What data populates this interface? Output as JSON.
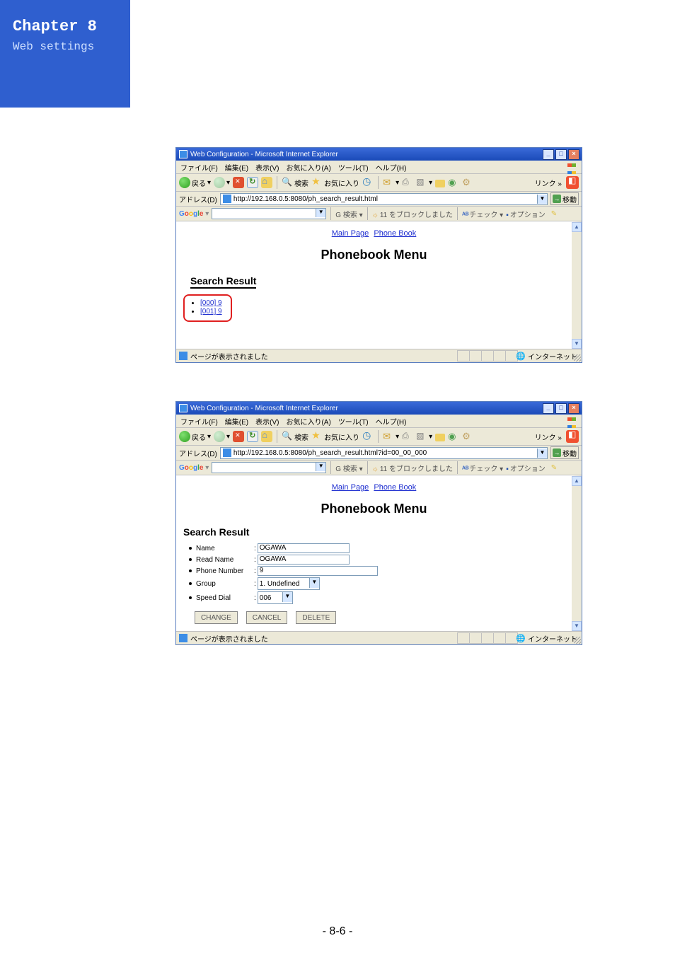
{
  "header": {
    "chapter": "Chapter 8",
    "subtitle": "Web settings"
  },
  "menus": [
    "ファイル(F)",
    "編集(E)",
    "表示(V)",
    "お気に入り(A)",
    "ツール(T)",
    "ヘルプ(H)"
  ],
  "toolbar": {
    "back": "戻る",
    "search": "検索",
    "favorites": "お気に入り",
    "links": "リンク"
  },
  "addr": {
    "label": "アドレス(D)",
    "go": "移動"
  },
  "gbar": {
    "search": "G 検索",
    "check": "チェック",
    "options": "オプション"
  },
  "status": {
    "zone": "インターネット"
  },
  "page": {
    "main_link": "Main Page",
    "phonebook_link": "Phone Book",
    "pb_title": "Phonebook Menu",
    "sr_title": "Search Result"
  },
  "win1": {
    "title": "Web Configuration - Microsoft Internet Explorer",
    "url": "http://192.168.0.5:8080/ph_search_result.html",
    "blocked": "11 をブロックしました",
    "results": [
      "[000] 9",
      "[001] 9"
    ],
    "status": "ページが表示されました"
  },
  "win2": {
    "title": "Web Configuration - Microsoft Internet Explorer",
    "url": "http://192.168.0.5:8080/ph_search_result.html?id=00_00_000",
    "blocked": "11 をブロックしました",
    "fields": {
      "name_label": "Name",
      "name_value": "OGAWA",
      "readname_label": "Read Name",
      "readname_value": "OGAWA",
      "phone_label": "Phone Number",
      "phone_value": "9",
      "group_label": "Group",
      "group_value": "1. Undefined",
      "speed_label": "Speed Dial",
      "speed_value": "006"
    },
    "buttons": {
      "change": "CHANGE",
      "cancel": "CANCEL",
      "delete": "DELETE"
    },
    "status": "ページが表示されました"
  },
  "footer": {
    "page": "- 8-6 -"
  }
}
